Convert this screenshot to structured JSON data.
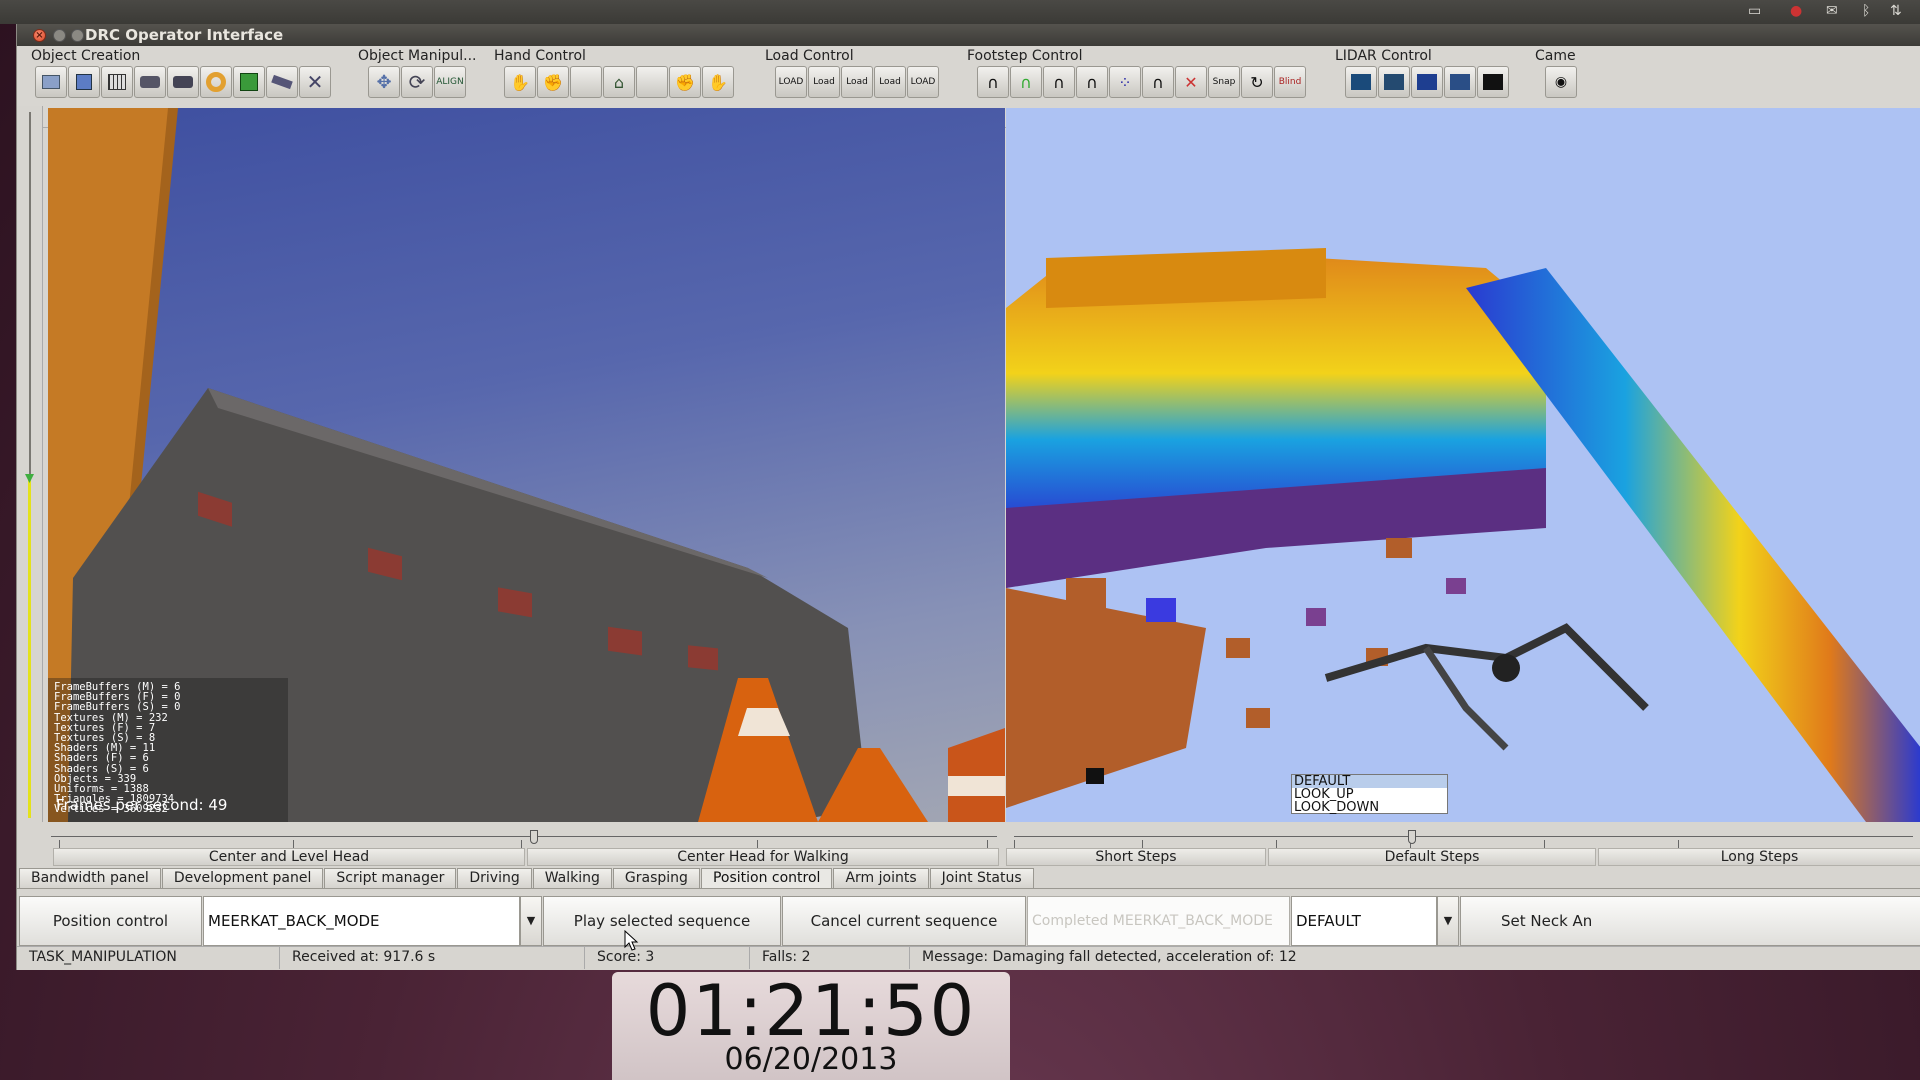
{
  "window": {
    "title": "DRC Operator Interface"
  },
  "toolbar": {
    "groups": [
      {
        "label": "Object Creation"
      },
      {
        "label": "Object Manipul..."
      },
      {
        "label": "Hand Control"
      },
      {
        "label": "Load Control"
      },
      {
        "label": "Footstep Control"
      },
      {
        "label": "LIDAR Control"
      },
      {
        "label": "Came"
      }
    ]
  },
  "stats": {
    "lines": [
      "FrameBuffers (M) = 6",
      "FrameBuffers (F) = 0",
      "FrameBuffers (S) = 0",
      "Textures (M) = 232",
      "Textures (F) = 7",
      "Textures (S) = 8",
      "Shaders (M) = 11",
      "Shaders (F) = 6",
      "Shaders (S) = 6",
      "Objects = 339",
      "Uniforms = 1388",
      "Triangles = 1809734",
      "Vertices = 3609232"
    ],
    "fps": "Frames per second: 49"
  },
  "head_slider": {
    "left_label": "Center and Level Head",
    "right_label": "Center Head for Walking"
  },
  "step_slider": {
    "short": "Short Steps",
    "default": "Default Steps",
    "long": "Long Steps"
  },
  "tabs": [
    "Bandwidth panel",
    "Development panel",
    "Script manager",
    "Driving",
    "Walking",
    "Grasping",
    "Position control",
    "Arm joints",
    "Joint Status"
  ],
  "active_tab": "Position control",
  "panel": {
    "position_control_btn": "Position control",
    "mode_combo": "MEERKAT_BACK_MODE",
    "play_btn": "Play selected sequence",
    "cancel_btn": "Cancel current sequence",
    "completed": "Completed MEERKAT_BACK_MODE",
    "neck_combo": "DEFAULT",
    "neck_btn": "Set Neck An",
    "neck_options": [
      "DEFAULT",
      "LOOK_UP",
      "LOOK_DOWN"
    ]
  },
  "status": {
    "task": "TASK_MANIPULATION",
    "received": "Received at: 917.6 s",
    "score": "Score: 3",
    "falls": "Falls: 2",
    "message": "Message: Damaging fall detected, acceleration of: 12"
  },
  "clock": {
    "time": "01:21:50",
    "date": "06/20/2013"
  }
}
